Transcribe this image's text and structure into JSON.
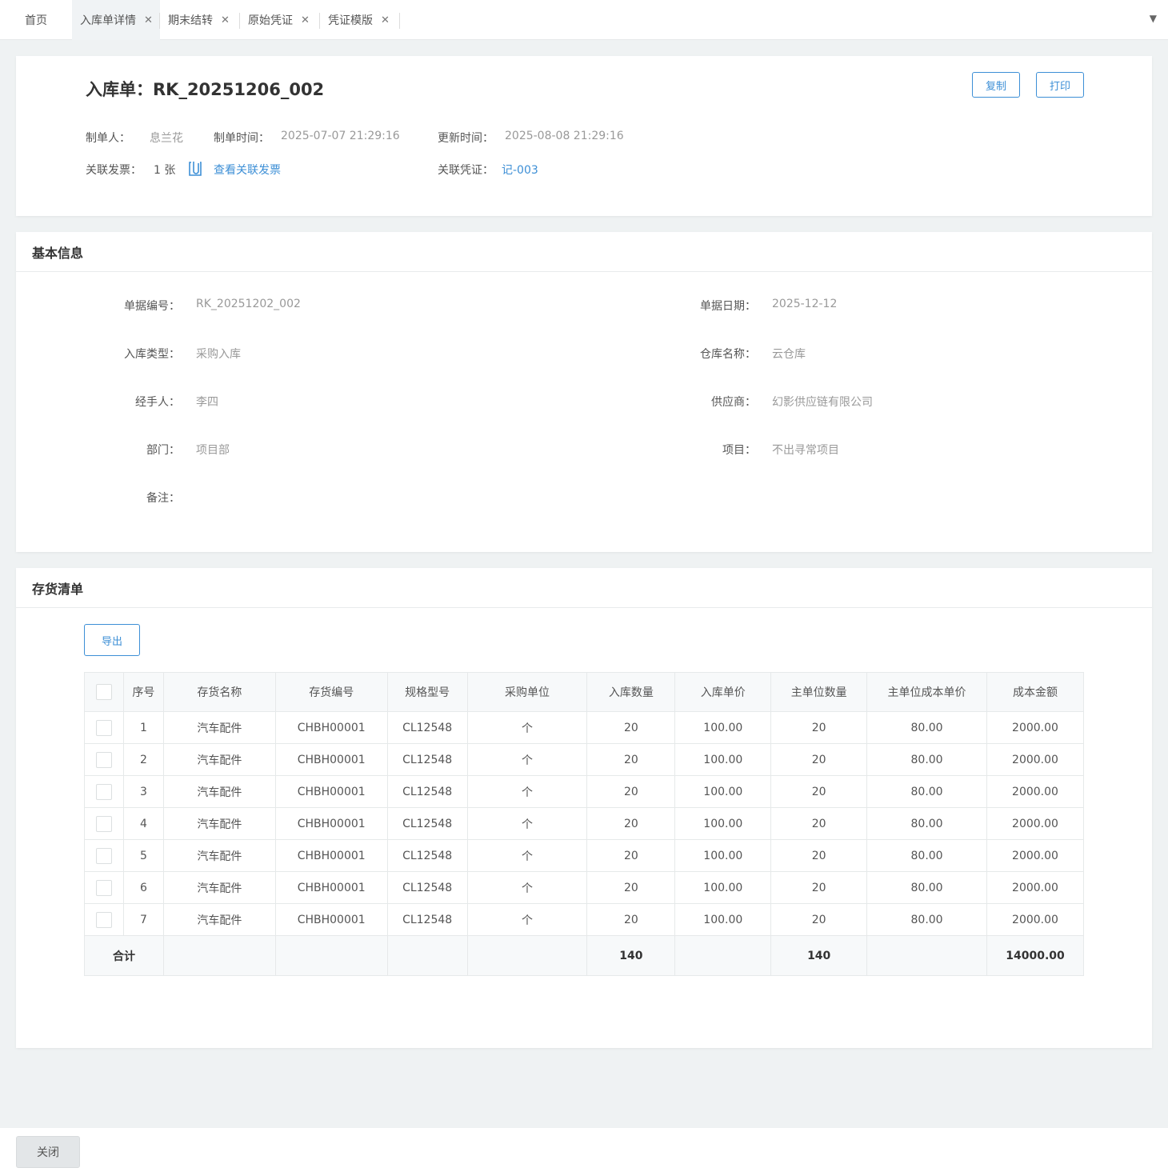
{
  "tabs": [
    {
      "label": "首页",
      "closable": false
    },
    {
      "label": "入库单详情",
      "closable": true
    },
    {
      "label": "期末结转",
      "closable": true
    },
    {
      "label": "原始凭证",
      "closable": true
    },
    {
      "label": "凭证模版",
      "closable": true
    }
  ],
  "tab_close_glyph": "✕",
  "tab_more_glyph": "▼",
  "header": {
    "title": "入库单：RK_20251206_002",
    "copy_label": "复制",
    "print_label": "打印",
    "creator_label": "制单人：",
    "creator": "息兰花",
    "created_label": "制单时间：",
    "created": "2025-07-07 21:29:16",
    "updated_label": "更新时间：",
    "updated": "2025-08-08 21:29:16",
    "invoice_label": "关联发票：",
    "invoice_count": "1 张",
    "invoice_link": "查看关联发票",
    "voucher_label": "关联凭证：",
    "voucher": "记-003"
  },
  "basic": {
    "section_title": "基本信息",
    "doc_no_label": "单据编号：",
    "doc_no": "RK_20251202_002",
    "doc_date_label": "单据日期：",
    "doc_date": "2025-12-12",
    "in_type_label": "入库类型：",
    "in_type": "采购入库",
    "warehouse_label": "仓库名称：",
    "warehouse": "云仓库",
    "handler_label": "经手人：",
    "handler": "李四",
    "supplier_label": "供应商：",
    "supplier": "幻影供应链有限公司",
    "dept_label": "部门：",
    "dept": "项目部",
    "project_label": "项目：",
    "project": "不出寻常项目",
    "remark_label": "备注：",
    "remark": ""
  },
  "inventory": {
    "section_title": "存货清单",
    "export_label": "导出",
    "columns": [
      "序号",
      "存货名称",
      "存货编号",
      "规格型号",
      "采购单位",
      "入库数量",
      "入库单价",
      "主单位数量",
      "主单位成本单价",
      "成本金额"
    ],
    "rows": [
      [
        "1",
        "汽车配件",
        "CHBH00001",
        "CL12548",
        "个",
        "20",
        "100.00",
        "20",
        "80.00",
        "2000.00"
      ],
      [
        "2",
        "汽车配件",
        "CHBH00001",
        "CL12548",
        "个",
        "20",
        "100.00",
        "20",
        "80.00",
        "2000.00"
      ],
      [
        "3",
        "汽车配件",
        "CHBH00001",
        "CL12548",
        "个",
        "20",
        "100.00",
        "20",
        "80.00",
        "2000.00"
      ],
      [
        "4",
        "汽车配件",
        "CHBH00001",
        "CL12548",
        "个",
        "20",
        "100.00",
        "20",
        "80.00",
        "2000.00"
      ],
      [
        "5",
        "汽车配件",
        "CHBH00001",
        "CL12548",
        "个",
        "20",
        "100.00",
        "20",
        "80.00",
        "2000.00"
      ],
      [
        "6",
        "汽车配件",
        "CHBH00001",
        "CL12548",
        "个",
        "20",
        "100.00",
        "20",
        "80.00",
        "2000.00"
      ],
      [
        "7",
        "汽车配件",
        "CHBH00001",
        "CL12548",
        "个",
        "20",
        "100.00",
        "20",
        "80.00",
        "2000.00"
      ]
    ],
    "total_label": "合计",
    "total_in_qty": "140",
    "total_main_qty": "140",
    "total_amount": "14000.00"
  },
  "footer": {
    "close_label": "关闭"
  },
  "colors": {
    "accent": "#3d8fd6",
    "background": "#eff2f3"
  }
}
